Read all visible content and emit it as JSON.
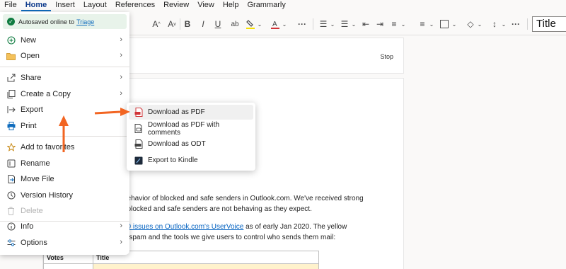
{
  "menubar": {
    "items": [
      "File",
      "Home",
      "Insert",
      "Layout",
      "References",
      "Review",
      "View",
      "Help",
      "Grammarly"
    ]
  },
  "ribbon": {
    "style_value": "Title"
  },
  "document": {
    "stop_label": "Stop",
    "para1_line1": "behavior of blocked and safe senders in Outlook.com. We've received strong",
    "para1_line2": "t blocked and safe senders are not behaving as they expect.",
    "para2_link": "10 issues on Outlook.com's UserVoice",
    "para2_rest": " as of early Jan 2020. The yellow",
    "para2_line2": "n spam and the tools we give users to control who sends them mail:",
    "table_headers": [
      "Votes",
      "Title"
    ]
  },
  "file_menu": {
    "autosave_text": "Autosaved online to",
    "autosave_link": "Triage",
    "items": [
      {
        "label": "New",
        "icon": "plus-circle-icon",
        "submenu": true
      },
      {
        "label": "Open",
        "icon": "folder-icon",
        "submenu": true
      },
      {
        "label": "Share",
        "icon": "share-icon",
        "submenu": true
      },
      {
        "label": "Create a Copy",
        "icon": "copy-icon",
        "submenu": true
      },
      {
        "label": "Export",
        "icon": "export-icon",
        "submenu": false
      },
      {
        "label": "Print",
        "icon": "printer-icon",
        "submenu": false
      },
      {
        "label": "Add to favorites",
        "icon": "star-icon",
        "submenu": false
      },
      {
        "label": "Rename",
        "icon": "rename-icon",
        "submenu": false
      },
      {
        "label": "Move File",
        "icon": "move-file-icon",
        "submenu": false
      },
      {
        "label": "Version History",
        "icon": "history-icon",
        "submenu": false
      },
      {
        "label": "Delete",
        "icon": "trash-icon",
        "submenu": false,
        "disabled": true
      },
      {
        "label": "Info",
        "icon": "info-icon",
        "submenu": true
      },
      {
        "label": "Options",
        "icon": "options-icon",
        "submenu": true
      }
    ]
  },
  "export_submenu": {
    "items": [
      {
        "label": "Download as PDF",
        "icon": "pdf-icon"
      },
      {
        "label": "Download as PDF with comments",
        "icon": "pdf-comments-icon"
      },
      {
        "label": "Download as ODT",
        "icon": "odt-icon"
      },
      {
        "label": "Export to Kindle",
        "icon": "kindle-icon"
      }
    ]
  },
  "colors": {
    "accent": "#0f6cbd",
    "annotation_arrow": "#f26522",
    "autosave_bg": "#e8f3ea",
    "table_highlight": "#fff2cc"
  }
}
